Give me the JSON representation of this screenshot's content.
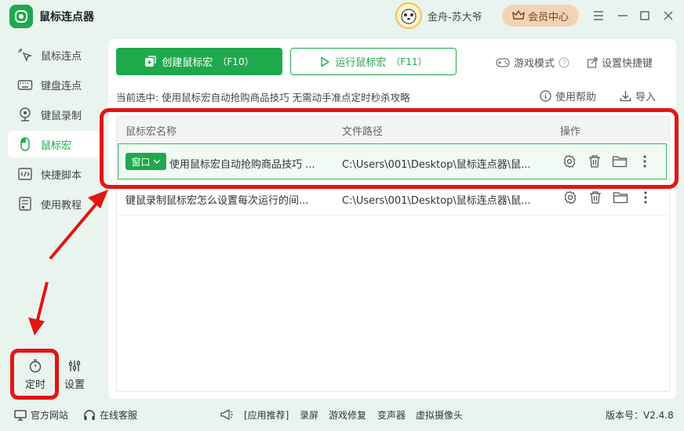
{
  "app": {
    "title": "鼠标连点器"
  },
  "user": {
    "name": "金舟-苏大爷",
    "vip_label": "会员中心"
  },
  "sidebar": {
    "items": [
      {
        "label": "鼠标连点",
        "icon": "mouse-click-icon",
        "active": false
      },
      {
        "label": "键盘连点",
        "icon": "keyboard-icon",
        "active": false
      },
      {
        "label": "键鼠录制",
        "icon": "record-icon",
        "active": false
      },
      {
        "label": "鼠标宏",
        "icon": "mouse-icon",
        "active": true
      },
      {
        "label": "快捷脚本",
        "icon": "script-icon",
        "active": false
      },
      {
        "label": "使用教程",
        "icon": "tutorial-icon",
        "active": false
      }
    ],
    "timer_label": "定时",
    "settings_label": "设置"
  },
  "toolbar": {
    "create_label": "创建鼠标宏",
    "create_key": "（F10）",
    "run_label": "运行鼠标宏",
    "run_key": "（F11）",
    "game_mode": "游戏模式",
    "shortcut": "设置快捷键",
    "help": "使用帮助",
    "import": "导入"
  },
  "selection": {
    "text": "当前选中:  使用鼠标宏自动抢购商品技巧 无需动手准点定时秒杀攻略"
  },
  "table": {
    "headers": [
      "鼠标宏名称",
      "文件路径",
      "操作"
    ],
    "rows": [
      {
        "badge": "窗口",
        "name": "使用鼠标宏自动抢购商品技巧 ...",
        "path": "C:\\Users\\001\\Desktop\\鼠标连点器\\鼠...",
        "selected": true
      },
      {
        "badge": "",
        "name": "键鼠录制鼠标宏怎么设置每次运行的间...",
        "path": "C:\\Users\\001\\Desktop\\鼠标连点器\\鼠...",
        "selected": false
      }
    ]
  },
  "footer": {
    "website": "官方网站",
    "support": "在线客服",
    "recommend": "[应用推荐]",
    "apps": [
      "录屏",
      "游戏修复",
      "变声器",
      "虚拟摄像头"
    ],
    "version": "版本号：V2.4.8"
  },
  "colors": {
    "accent": "#1fa94d",
    "annotation": "#e31414",
    "vip_bg": "#f3d3b7"
  }
}
